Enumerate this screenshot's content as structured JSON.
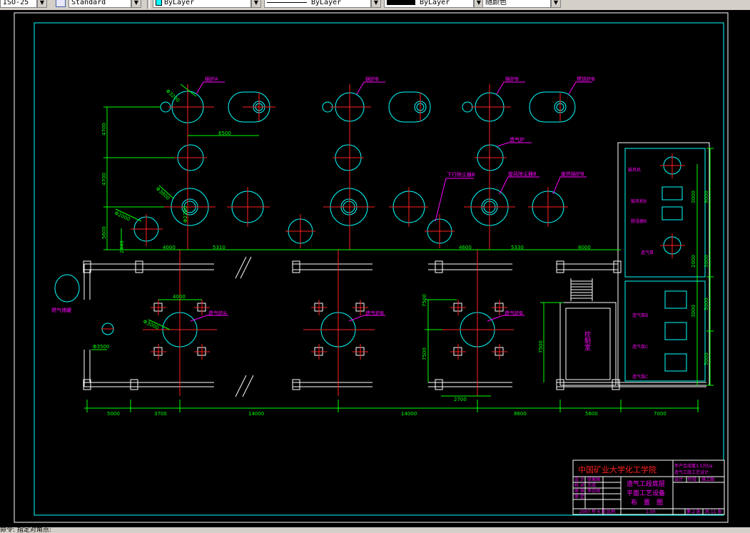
{
  "toolbar": {
    "dimstyle_value": "ISO-25",
    "textstyle_value": "Standard",
    "layer_color_value": "ByLayer",
    "linetype_value": "ByLayer",
    "lineweight_value": "ByLayer",
    "plotstyle_value": "随颜色"
  },
  "labels": {
    "boiler_1": "锅炉A",
    "boiler_2": "锅炉B",
    "gasifier": "造气炉",
    "stove_2": "燃烧炉B",
    "cyclone": "旋风除尘器A",
    "cyclone_2": "旋风除尘器B",
    "waste_heat": "废热锅炉B",
    "lower_dust": "下行除尘器B",
    "dehydrator": "脱湿器B",
    "furnace_a": "造气炉A",
    "furnace_b": "造气炉B",
    "furnace_c": "造气炉B",
    "gas_tank": "燃气储罐",
    "control_room": "控制室",
    "fan_1": "鼓风机",
    "fan_2": "鼓风机B",
    "pump_1": "造气泵",
    "pump_2": "造气泵B",
    "pump_3": "造气泵C"
  },
  "dims": {
    "d1": "6500",
    "d2": "4700",
    "d3": "4700",
    "d4": "5600",
    "d5": "2440",
    "d6": "4000",
    "d7": "5310",
    "d8": "4600",
    "d9": "5330",
    "d10": "8000",
    "d11": "4000",
    "d12": "7500",
    "d13": "7500",
    "d14": "2700",
    "d15": "7500",
    "d16": "9000",
    "d17": "3000",
    "d18": "2000",
    "d19": "3000",
    "d20": "3000",
    "d21": "5000",
    "d22": "5000",
    "b1": "5000",
    "b2": "3700",
    "b3": "14000",
    "b4": "14000",
    "b5": "8600",
    "b6": "5600",
    "b7": "7000",
    "pipe1": "Φ3200",
    "pipe2": "Φ3800",
    "pipe3": "Φ2000",
    "pipe4": "Φ3000",
    "pipe5": "Φ3500",
    "h1": "Φ2200"
  },
  "title_block": {
    "school": "中国矿业大学化工学院",
    "project_1": "年产合成氨3.5万t/a",
    "project_2": "造气工段工艺设计",
    "drawing_1": "造气工段底层",
    "drawing_2": "平面工艺设备",
    "drawing_3": "布　置　图",
    "row1_a": "设  计",
    "row1_b": "张家国",
    "row2_a": "校  对",
    "row2_b": "王成",
    "row3_a": "审  核",
    "row3_b": "李志明",
    "row4_a": "审  定",
    "row4_b": "",
    "right_1": "设计",
    "right_2": "阶段",
    "right_3": "施工图",
    "date": "2007 年 6 月",
    "scale_label": "比例",
    "scale_value": "1:50",
    "sheet": "第 2 张",
    "total": "共 11 张"
  },
  "command_line": "命令: 指定对角点:"
}
